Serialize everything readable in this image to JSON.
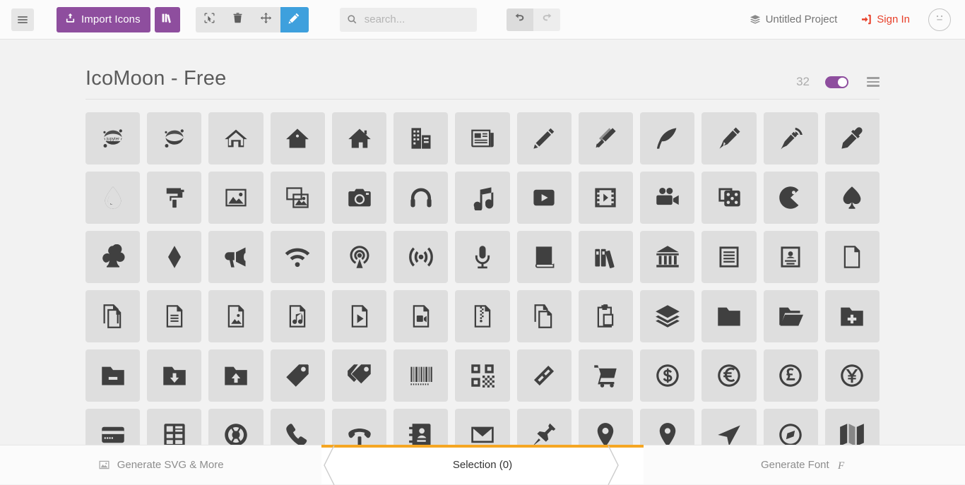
{
  "toolbar": {
    "menu_icon": "hamburger-icon",
    "import_label": "Import Icons",
    "import_icon": "upload-icon",
    "library_icon": "library-icon",
    "tools": [
      {
        "name": "select-tool",
        "icon": "cursor-select-icon",
        "active": false
      },
      {
        "name": "delete-tool",
        "icon": "trash-icon",
        "active": false
      },
      {
        "name": "move-tool",
        "icon": "move-arrows-icon",
        "active": false
      },
      {
        "name": "edit-tool",
        "icon": "pencil-icon",
        "active": true
      }
    ],
    "search": {
      "placeholder": "search...",
      "value": "",
      "icon": "search-icon"
    },
    "undo_icon": "undo-arrow-icon",
    "redo_icon": "redo-arrow-icon",
    "project_name": "Untitled Project",
    "project_icon": "stack-icon",
    "sign_in_label": "Sign In",
    "sign_in_icon": "login-icon",
    "avatar_icon": "neutral-face-icon",
    "accent_purple": "#8e4e9e",
    "accent_blue": "#3ea0dd",
    "accent_red": "#e8402a"
  },
  "set": {
    "title": "IcoMoon - Free",
    "count": "32",
    "toggle_on": true,
    "toggle_color": "#8e4e9e",
    "menu_icon": "hamburger-icon"
  },
  "grid": {
    "columns": 13,
    "icons": [
      {
        "name": "jupyter"
      },
      {
        "name": "jupyter-plain"
      },
      {
        "name": "home"
      },
      {
        "name": "home2"
      },
      {
        "name": "home3"
      },
      {
        "name": "office"
      },
      {
        "name": "newspaper"
      },
      {
        "name": "pencil"
      },
      {
        "name": "pencil2"
      },
      {
        "name": "quill"
      },
      {
        "name": "pen"
      },
      {
        "name": "blog"
      },
      {
        "name": "eyedropper"
      },
      {
        "name": "droplet"
      },
      {
        "name": "paint-format"
      },
      {
        "name": "image"
      },
      {
        "name": "images"
      },
      {
        "name": "camera"
      },
      {
        "name": "headphones"
      },
      {
        "name": "music"
      },
      {
        "name": "play"
      },
      {
        "name": "film"
      },
      {
        "name": "video-camera"
      },
      {
        "name": "dice"
      },
      {
        "name": "pacman"
      },
      {
        "name": "spades"
      },
      {
        "name": "clubs"
      },
      {
        "name": "diamonds"
      },
      {
        "name": "bullhorn"
      },
      {
        "name": "connection"
      },
      {
        "name": "podcast"
      },
      {
        "name": "feed"
      },
      {
        "name": "mic"
      },
      {
        "name": "book"
      },
      {
        "name": "books"
      },
      {
        "name": "library"
      },
      {
        "name": "file-text"
      },
      {
        "name": "profile"
      },
      {
        "name": "file-empty"
      },
      {
        "name": "files-empty"
      },
      {
        "name": "file-text2"
      },
      {
        "name": "file-picture"
      },
      {
        "name": "file-music"
      },
      {
        "name": "file-play"
      },
      {
        "name": "file-video"
      },
      {
        "name": "file-zip"
      },
      {
        "name": "copy"
      },
      {
        "name": "paste"
      },
      {
        "name": "stack"
      },
      {
        "name": "folder"
      },
      {
        "name": "folder-open"
      },
      {
        "name": "folder-plus"
      },
      {
        "name": "folder-minus"
      },
      {
        "name": "folder-download"
      },
      {
        "name": "folder-upload"
      },
      {
        "name": "price-tag"
      },
      {
        "name": "price-tags"
      },
      {
        "name": "barcode"
      },
      {
        "name": "qrcode"
      },
      {
        "name": "ticket"
      },
      {
        "name": "cart"
      },
      {
        "name": "coin-dollar"
      },
      {
        "name": "coin-euro"
      },
      {
        "name": "coin-pound"
      },
      {
        "name": "coin-yen"
      },
      {
        "name": "credit-card"
      },
      {
        "name": "calculator"
      },
      {
        "name": "lifebuoy"
      },
      {
        "name": "phone"
      },
      {
        "name": "phone-hang-up"
      },
      {
        "name": "address-book"
      },
      {
        "name": "envelop"
      },
      {
        "name": "pushpin"
      },
      {
        "name": "location"
      },
      {
        "name": "location2"
      },
      {
        "name": "compass"
      },
      {
        "name": "compass2"
      },
      {
        "name": "map"
      }
    ]
  },
  "bottom_bar": {
    "left_label": "Generate SVG & More",
    "left_icon": "image-icon",
    "center_label": "Selection (0)",
    "right_label": "Generate Font",
    "right_icon": "font-f-icon",
    "active_accent": "#f5a623"
  }
}
